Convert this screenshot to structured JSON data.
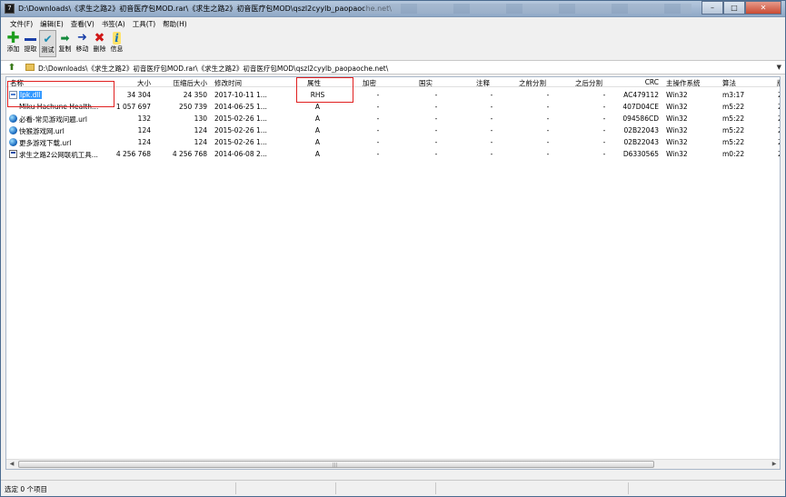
{
  "window": {
    "title": "D:\\Downloads\\《求生之路2》初音医疗包MOD.rar\\《求生之路2》初音医疗包MOD\\qszl2cyylb_paopaoche.net\\",
    "controls": {
      "minimize": "–",
      "maximize": "□",
      "close": "✕"
    }
  },
  "menu": [
    "文件(F)",
    "编辑(E)",
    "查看(V)",
    "书签(A)",
    "工具(T)",
    "帮助(H)"
  ],
  "toolbar": [
    {
      "label": "添加",
      "icon": "add-icon"
    },
    {
      "label": "提取",
      "icon": "extract-icon"
    },
    {
      "label": "测试",
      "icon": "test-icon"
    },
    {
      "label": "复制",
      "icon": "copy-icon"
    },
    {
      "label": "移动",
      "icon": "move-icon"
    },
    {
      "label": "删除",
      "icon": "delete-icon"
    },
    {
      "label": "信息",
      "icon": "info-icon"
    }
  ],
  "address": {
    "path": "D:\\Downloads\\《求生之路2》初音医疗包MOD.rar\\《求生之路2》初音医疗包MOD\\qszl2cyylb_paopaoche.net\\"
  },
  "columns": [
    "名称",
    "大小",
    "压缩后大小",
    "修改时间",
    "属性",
    "加密",
    "注释",
    "之前分割",
    "之后分割",
    "CRC",
    "主操作系统",
    "算法"
  ],
  "extra_columns": [
    "国实"
  ],
  "files": [
    {
      "name": "lpk.dll",
      "icon": "dll",
      "size": "34 304",
      "packed": "24 350",
      "modified": "2017-10-11 1...",
      "attr": "RHS",
      "encrypted": "-",
      "col2": "-",
      "comment": "-",
      "split_before": "-",
      "split_after": "-",
      "crc": "AC479112",
      "os": "Win32",
      "method": "m3:17",
      "extra": "2"
    },
    {
      "name": "Miku Hachune Health...",
      "icon": "none",
      "size": "1 057 697",
      "packed": "250 739",
      "modified": "2014-06-25 1...",
      "attr": "A",
      "encrypted": "-",
      "col2": "-",
      "comment": "-",
      "split_before": "-",
      "split_after": "-",
      "crc": "407D04CE",
      "os": "Win32",
      "method": "m5:22",
      "extra": "2"
    },
    {
      "name": "必看-常见游戏问题.url",
      "icon": "url",
      "size": "132",
      "packed": "130",
      "modified": "2015-02-26 1...",
      "attr": "A",
      "encrypted": "-",
      "col2": "-",
      "comment": "-",
      "split_before": "-",
      "split_after": "-",
      "crc": "094586CD",
      "os": "Win32",
      "method": "m5:22",
      "extra": "2"
    },
    {
      "name": "快猴游戏网.url",
      "icon": "url",
      "size": "124",
      "packed": "124",
      "modified": "2015-02-26 1...",
      "attr": "A",
      "encrypted": "-",
      "col2": "-",
      "comment": "-",
      "split_before": "-",
      "split_after": "-",
      "crc": "02B22043",
      "os": "Win32",
      "method": "m5:22",
      "extra": "2"
    },
    {
      "name": "更多游戏下载.url",
      "icon": "url",
      "size": "124",
      "packed": "124",
      "modified": "2015-02-26 1...",
      "attr": "A",
      "encrypted": "-",
      "col2": "-",
      "comment": "-",
      "split_before": "-",
      "split_after": "-",
      "crc": "02B22043",
      "os": "Win32",
      "method": "m5:22",
      "extra": "2"
    },
    {
      "name": "求生之路2公网联机工具...",
      "icon": "exe",
      "size": "4 256 768",
      "packed": "4 256 768",
      "modified": "2014-06-08 2...",
      "attr": "A",
      "encrypted": "-",
      "col2": "-",
      "comment": "-",
      "split_before": "-",
      "split_after": "-",
      "crc": "D6330565",
      "os": "Win32",
      "method": "m0:22",
      "extra": "2"
    }
  ],
  "status": {
    "text": "选定 0 个项目"
  },
  "colors": {
    "selection": "#3399ff",
    "highlight_box": "#e02020",
    "title_gradient": "#b7c9de"
  }
}
